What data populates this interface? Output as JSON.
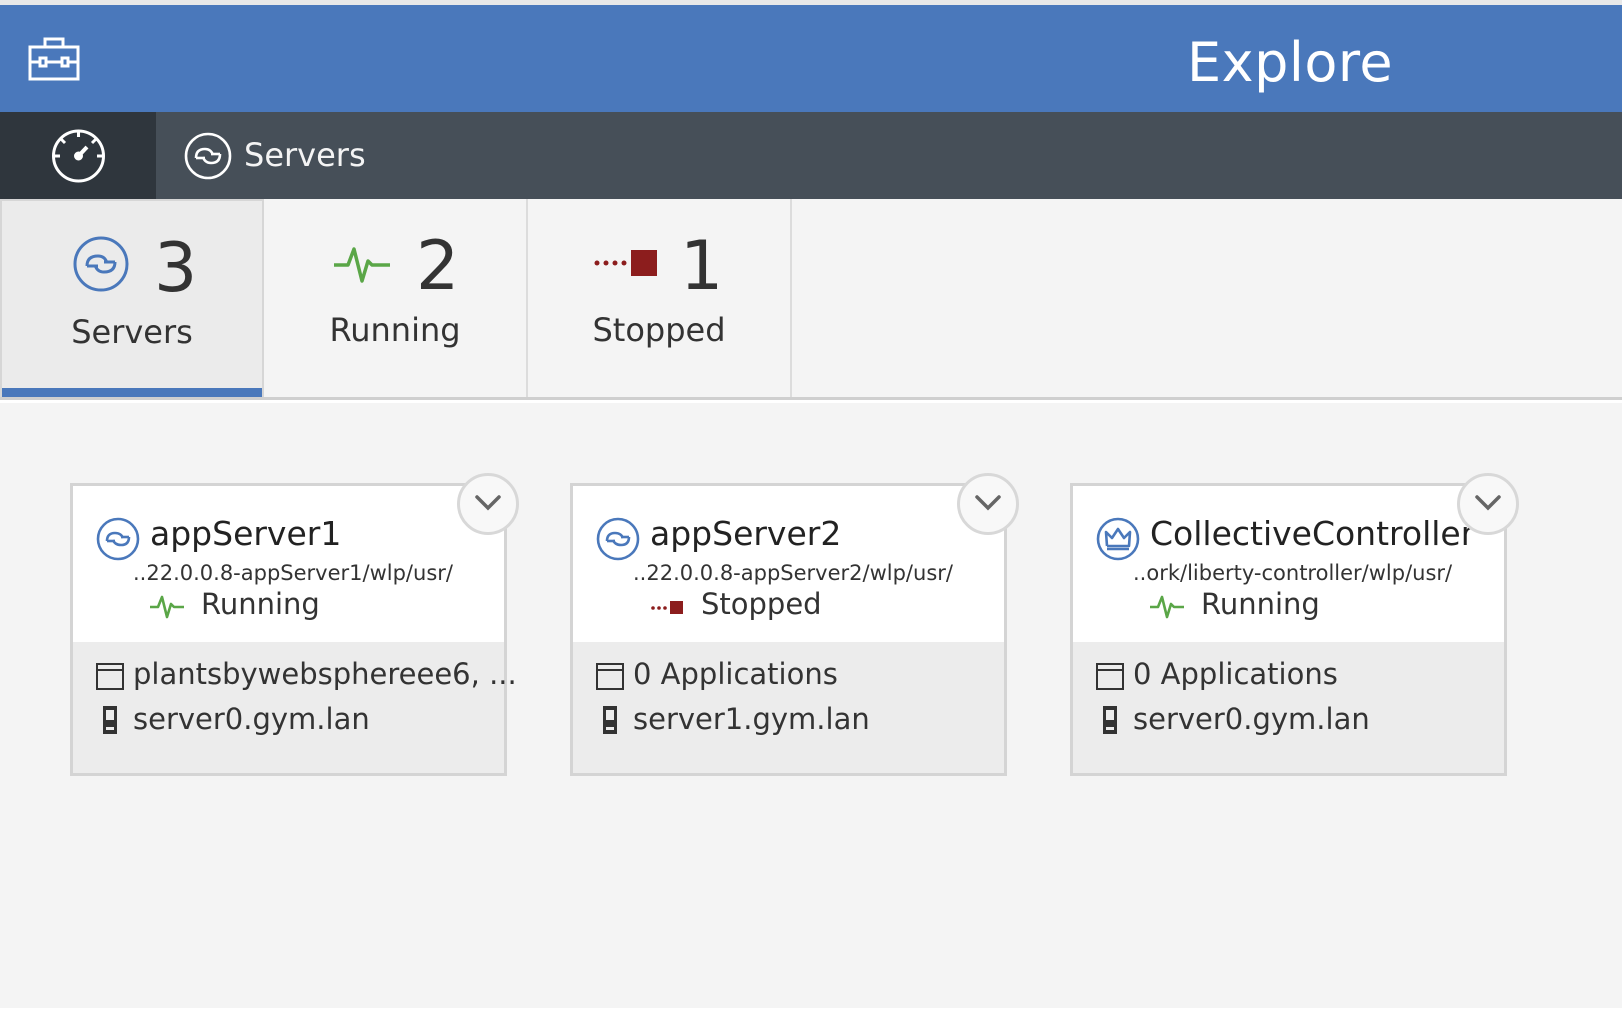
{
  "header": {
    "title": "Explore",
    "toolbox_icon": "toolbox-icon"
  },
  "nav": {
    "dashboard_icon": "dashboard-gauge-icon",
    "servers_icon": "server-icon",
    "servers_label": "Servers"
  },
  "filters": [
    {
      "count": "3",
      "label": "Servers",
      "icon": "server-icon",
      "active": true
    },
    {
      "count": "2",
      "label": "Running",
      "icon": "running-pulse-icon",
      "active": false
    },
    {
      "count": "1",
      "label": "Stopped",
      "icon": "stopped-icon",
      "active": false
    }
  ],
  "colors": {
    "brand": "#4a78bb",
    "running": "#5aa647",
    "stopped": "#8c1d1d",
    "nav": "#464f58",
    "nav_active": "#2f363d"
  },
  "servers": [
    {
      "name": "appServer1",
      "path": "..22.0.0.8-appServer1/wlp/usr/",
      "status": "Running",
      "apps": "plantsbywebsphereee6, ...",
      "host": "server0.gym.lan",
      "icon": "server-icon"
    },
    {
      "name": "appServer2",
      "path": "..22.0.0.8-appServer2/wlp/usr/",
      "status": "Stopped",
      "apps": "0 Applications",
      "host": "server1.gym.lan",
      "icon": "server-icon"
    },
    {
      "name": "CollectiveController",
      "path": "..ork/liberty-controller/wlp/usr/",
      "status": "Running",
      "apps": "0 Applications",
      "host": "server0.gym.lan",
      "icon": "collective-controller-crown-icon"
    }
  ]
}
